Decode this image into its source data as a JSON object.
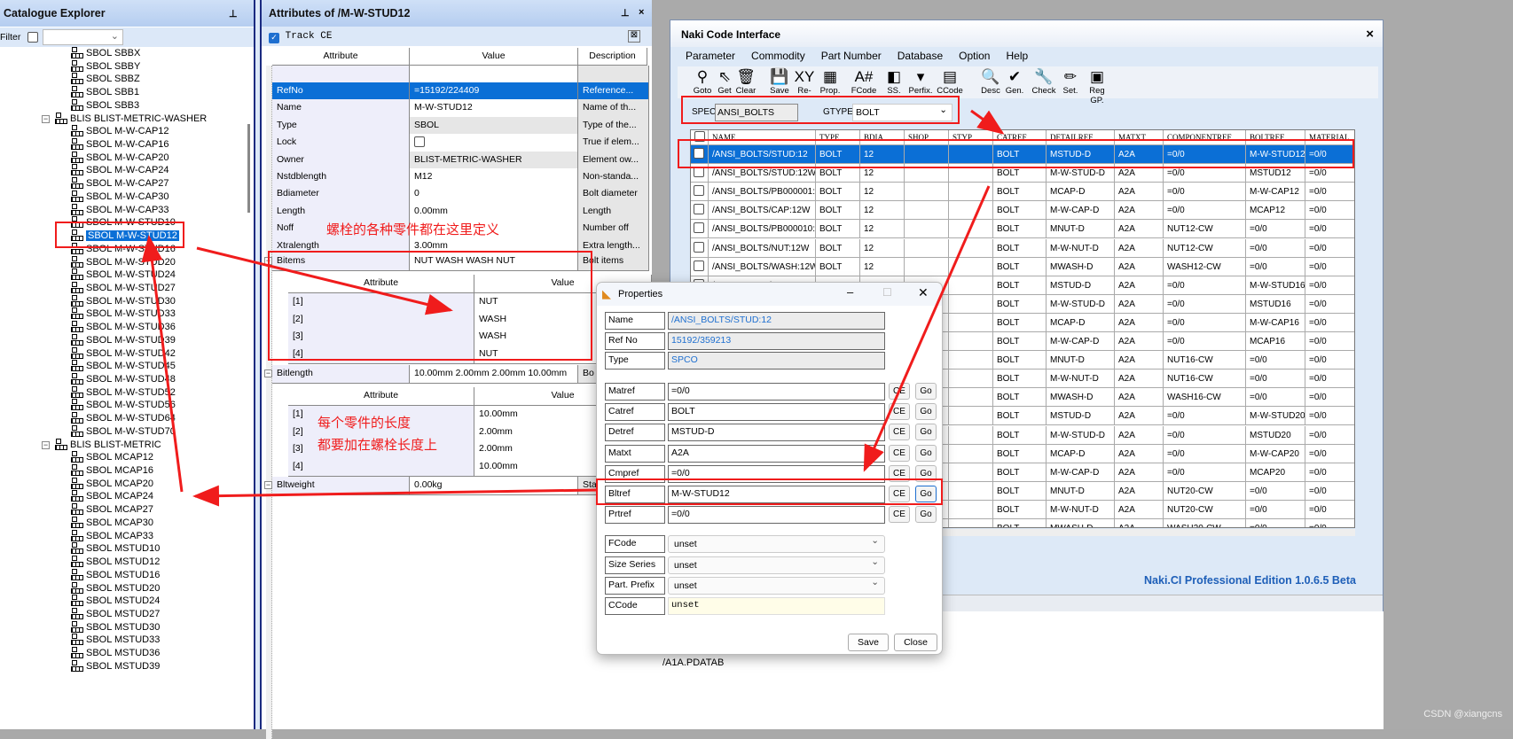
{
  "catalogue": {
    "title": "Catalogue Explorer",
    "filter_label": "Filter",
    "filter_value": "",
    "items": [
      {
        "label": "SBOL SBBX",
        "level": 1
      },
      {
        "label": "SBOL SBBY",
        "level": 1
      },
      {
        "label": "SBOL SBBZ",
        "level": 1
      },
      {
        "label": "SBOL SBB1",
        "level": 1
      },
      {
        "label": "SBOL SBB3",
        "level": 1
      },
      {
        "label": "BLIS BLIST-METRIC-WASHER",
        "level": 0
      },
      {
        "label": "SBOL M-W-CAP12",
        "level": 1
      },
      {
        "label": "SBOL M-W-CAP16",
        "level": 1
      },
      {
        "label": "SBOL M-W-CAP20",
        "level": 1
      },
      {
        "label": "SBOL M-W-CAP24",
        "level": 1
      },
      {
        "label": "SBOL M-W-CAP27",
        "level": 1
      },
      {
        "label": "SBOL M-W-CAP30",
        "level": 1
      },
      {
        "label": "SBOL M-W-CAP33",
        "level": 1
      },
      {
        "label": "SBOL M-W-STUD10",
        "level": 1
      },
      {
        "label": "SBOL M-W-STUD12",
        "level": 1,
        "selected": true
      },
      {
        "label": "SBOL M-W-STUD16",
        "level": 1
      },
      {
        "label": "SBOL M-W-STUD20",
        "level": 1
      },
      {
        "label": "SBOL M-W-STUD24",
        "level": 1
      },
      {
        "label": "SBOL M-W-STUD27",
        "level": 1
      },
      {
        "label": "SBOL M-W-STUD30",
        "level": 1
      },
      {
        "label": "SBOL M-W-STUD33",
        "level": 1
      },
      {
        "label": "SBOL M-W-STUD36",
        "level": 1
      },
      {
        "label": "SBOL M-W-STUD39",
        "level": 1
      },
      {
        "label": "SBOL M-W-STUD42",
        "level": 1
      },
      {
        "label": "SBOL M-W-STUD45",
        "level": 1
      },
      {
        "label": "SBOL M-W-STUD48",
        "level": 1
      },
      {
        "label": "SBOL M-W-STUD52",
        "level": 1
      },
      {
        "label": "SBOL M-W-STUD56",
        "level": 1
      },
      {
        "label": "SBOL M-W-STUD64",
        "level": 1
      },
      {
        "label": "SBOL M-W-STUD70",
        "level": 1
      },
      {
        "label": "BLIS BLIST-METRIC",
        "level": 0
      },
      {
        "label": "SBOL MCAP12",
        "level": 1
      },
      {
        "label": "SBOL MCAP16",
        "level": 1
      },
      {
        "label": "SBOL MCAP20",
        "level": 1
      },
      {
        "label": "SBOL MCAP24",
        "level": 1
      },
      {
        "label": "SBOL MCAP27",
        "level": 1
      },
      {
        "label": "SBOL MCAP30",
        "level": 1
      },
      {
        "label": "SBOL MCAP33",
        "level": 1
      },
      {
        "label": "SBOL MSTUD10",
        "level": 1
      },
      {
        "label": "SBOL MSTUD12",
        "level": 1
      },
      {
        "label": "SBOL MSTUD16",
        "level": 1
      },
      {
        "label": "SBOL MSTUD20",
        "level": 1
      },
      {
        "label": "SBOL MSTUD24",
        "level": 1
      },
      {
        "label": "SBOL MSTUD27",
        "level": 1
      },
      {
        "label": "SBOL MSTUD30",
        "level": 1
      },
      {
        "label": "SBOL MSTUD33",
        "level": 1
      },
      {
        "label": "SBOL MSTUD36",
        "level": 1
      },
      {
        "label": "SBOL MSTUD39",
        "level": 1
      }
    ]
  },
  "attributes": {
    "title": "Attributes of /M-W-STUD12",
    "track_ce": "Track CE",
    "headers": [
      "Attribute",
      "Value",
      "Description"
    ],
    "rows": [
      {
        "name": "RefNo",
        "value": "=15192/224409",
        "desc": "Reference...",
        "selected": true
      },
      {
        "name": "Name",
        "value": "M-W-STUD12",
        "desc": "Name of th..."
      },
      {
        "name": "Type",
        "value": "SBOL",
        "desc": "Type of the...",
        "readonly": true
      },
      {
        "name": "Lock",
        "value": "",
        "desc": "True if elem...",
        "checkbox": true
      },
      {
        "name": "Owner",
        "value": "BLIST-METRIC-WASHER",
        "desc": "Element ow...",
        "readonly": true
      },
      {
        "name": "Nstdblength",
        "value": "M12",
        "desc": "Non-standa..."
      },
      {
        "name": "Bdiameter",
        "value": "0",
        "desc": "Bolt diameter"
      },
      {
        "name": "Length",
        "value": "0.00mm",
        "desc": "Length"
      },
      {
        "name": "Noff",
        "value": "",
        "desc": "Number off"
      },
      {
        "name": "Xtralength",
        "value": "3.00mm",
        "desc": "Extra length..."
      }
    ],
    "bitems": {
      "name": "Bitems",
      "value": "NUT WASH WASH NUT",
      "desc": "Bolt items",
      "sub_headers": [
        "Attribute",
        "Value"
      ],
      "items": [
        {
          "idx": "[1]",
          "value": "NUT"
        },
        {
          "idx": "[2]",
          "value": "WASH"
        },
        {
          "idx": "[3]",
          "value": "WASH"
        },
        {
          "idx": "[4]",
          "value": "NUT"
        }
      ]
    },
    "bitlength": {
      "name": "Bitlength",
      "value": "10.00mm 2.00mm 2.00mm 10.00mm",
      "desc": "Bo",
      "sub_headers": [
        "Attribute",
        "Value"
      ],
      "items": [
        {
          "idx": "[1]",
          "value": "10.00mm"
        },
        {
          "idx": "[2]",
          "value": "2.00mm"
        },
        {
          "idx": "[3]",
          "value": "2.00mm"
        },
        {
          "idx": "[4]",
          "value": "10.00mm"
        }
      ]
    },
    "bltweight": {
      "name": "Bltweight",
      "value": "0.00kg",
      "desc": "Sta"
    }
  },
  "naki": {
    "title": "Naki Code Interface",
    "close": "×",
    "menu": [
      "Parameter",
      "Commodity",
      "Part Number",
      "Database",
      "Option",
      "Help"
    ],
    "toolbar": [
      {
        "label": "Goto",
        "icon": "goto-icon",
        "glyph": "⚲"
      },
      {
        "label": "Get",
        "icon": "cursor-icon",
        "glyph": "⇖"
      },
      {
        "label": "Clear",
        "icon": "trash-icon",
        "glyph": "🗑"
      },
      {
        "label": "Save",
        "icon": "floppy-icon",
        "glyph": "💾"
      },
      {
        "label": "Re-",
        "icon": "xy-icon",
        "glyph": "XY"
      },
      {
        "label": "Prop.",
        "icon": "grid-icon",
        "glyph": "▦"
      },
      {
        "label": "FCode",
        "icon": "format-icon",
        "glyph": "A#"
      },
      {
        "label": "SS.",
        "icon": "squares-icon",
        "glyph": "◧"
      },
      {
        "label": "Perfix.",
        "icon": "perfix-icon",
        "glyph": "▾"
      },
      {
        "label": "CCode",
        "icon": "ccode-icon",
        "glyph": "▤"
      },
      {
        "label": "Desc",
        "icon": "search-icon",
        "glyph": "🔍"
      },
      {
        "label": "Gen.",
        "icon": "check-icon",
        "glyph": "✔"
      },
      {
        "label": "Check",
        "icon": "wrench-icon",
        "glyph": "🔧"
      },
      {
        "label": "Set.",
        "icon": "pencil-icon",
        "glyph": "✏"
      },
      {
        "label": "Reg GP.",
        "icon": "box-icon",
        "glyph": "▣"
      }
    ],
    "spec_label": "SPEC",
    "spec_value": "ANSI_BOLTS",
    "gtype_label": "GTYPE",
    "gtype_value": "BOLT",
    "columns": [
      "NAME",
      "TYPE",
      "BDIA",
      "SHOP",
      "STYP",
      "CATREF",
      "DETAILREF",
      "MATXT",
      "COMPONENTREF",
      "BOLTREF",
      "MATERIAL"
    ],
    "rows": [
      [
        "/ANSI_BOLTS/STUD:12",
        "BOLT",
        "12",
        "",
        "",
        "BOLT",
        "MSTUD-D",
        "A2A",
        "=0/0",
        "M-W-STUD12",
        "=0/0"
      ],
      [
        "/ANSI_BOLTS/STUD:12W",
        "BOLT",
        "12",
        "",
        "",
        "BOLT",
        "M-W-STUD-D",
        "A2A",
        "=0/0",
        "MSTUD12",
        "=0/0"
      ],
      [
        "/ANSI_BOLTS/PB000001:12",
        "BOLT",
        "12",
        "",
        "",
        "BOLT",
        "MCAP-D",
        "A2A",
        "=0/0",
        "M-W-CAP12",
        "=0/0"
      ],
      [
        "/ANSI_BOLTS/CAP:12W",
        "BOLT",
        "12",
        "",
        "",
        "BOLT",
        "M-W-CAP-D",
        "A2A",
        "=0/0",
        "MCAP12",
        "=0/0"
      ],
      [
        "/ANSI_BOLTS/PB000010:12",
        "BOLT",
        "12",
        "",
        "",
        "BOLT",
        "MNUT-D",
        "A2A",
        "NUT12-CW",
        "=0/0",
        "=0/0"
      ],
      [
        "/ANSI_BOLTS/NUT:12W",
        "BOLT",
        "12",
        "",
        "",
        "BOLT",
        "M-W-NUT-D",
        "A2A",
        "NUT12-CW",
        "=0/0",
        "=0/0"
      ],
      [
        "/ANSI_BOLTS/WASH:12W",
        "BOLT",
        "12",
        "",
        "",
        "BOLT",
        "MWASH-D",
        "A2A",
        "WASH12-CW",
        "=0/0",
        "=0/0"
      ],
      [
        "/ANSI_BOLTS/STUD:16",
        "BOLT",
        "16",
        "",
        "",
        "BOLT",
        "MSTUD-D",
        "A2A",
        "=0/0",
        "M-W-STUD16",
        "=0/0"
      ],
      [
        "",
        "",
        "",
        "",
        "",
        "BOLT",
        "M-W-STUD-D",
        "A2A",
        "=0/0",
        "MSTUD16",
        "=0/0"
      ],
      [
        "",
        "",
        "",
        "",
        "",
        "BOLT",
        "MCAP-D",
        "A2A",
        "=0/0",
        "M-W-CAP16",
        "=0/0"
      ],
      [
        "",
        "",
        "",
        "",
        "",
        "BOLT",
        "M-W-CAP-D",
        "A2A",
        "=0/0",
        "MCAP16",
        "=0/0"
      ],
      [
        "",
        "",
        "",
        "",
        "",
        "BOLT",
        "MNUT-D",
        "A2A",
        "NUT16-CW",
        "=0/0",
        "=0/0"
      ],
      [
        "",
        "",
        "",
        "",
        "",
        "BOLT",
        "M-W-NUT-D",
        "A2A",
        "NUT16-CW",
        "=0/0",
        "=0/0"
      ],
      [
        "",
        "",
        "",
        "",
        "",
        "BOLT",
        "MWASH-D",
        "A2A",
        "WASH16-CW",
        "=0/0",
        "=0/0"
      ],
      [
        "",
        "",
        "",
        "",
        "",
        "BOLT",
        "MSTUD-D",
        "A2A",
        "=0/0",
        "M-W-STUD20",
        "=0/0"
      ],
      [
        "",
        "",
        "",
        "",
        "",
        "BOLT",
        "M-W-STUD-D",
        "A2A",
        "=0/0",
        "MSTUD20",
        "=0/0"
      ],
      [
        "",
        "",
        "",
        "",
        "",
        "BOLT",
        "MCAP-D",
        "A2A",
        "=0/0",
        "M-W-CAP20",
        "=0/0"
      ],
      [
        "",
        "",
        "",
        "",
        "",
        "BOLT",
        "M-W-CAP-D",
        "A2A",
        "=0/0",
        "MCAP20",
        "=0/0"
      ],
      [
        "",
        "",
        "",
        "",
        "",
        "BOLT",
        "MNUT-D",
        "A2A",
        "NUT20-CW",
        "=0/0",
        "=0/0"
      ],
      [
        "",
        "",
        "",
        "",
        "",
        "BOLT",
        "M-W-NUT-D",
        "A2A",
        "NUT20-CW",
        "=0/0",
        "=0/0"
      ],
      [
        "",
        "",
        "",
        "",
        "",
        "BOLT",
        "MWASH-D",
        "A2A",
        "WASH20-CW",
        "=0/0",
        "=0/0"
      ]
    ],
    "footer": "Naki.CI Professional Edition 1.0.6.5 Beta"
  },
  "properties": {
    "title": "Properties",
    "readonly": [
      {
        "label": "Name",
        "value": "/ANSI_BOLTS/STUD:12"
      },
      {
        "label": "Ref No",
        "value": "15192/359213"
      },
      {
        "label": "Type",
        "value": "SPCO"
      }
    ],
    "refs": [
      {
        "label": "Matref",
        "value": "=0/0"
      },
      {
        "label": "Catref",
        "value": "BOLT"
      },
      {
        "label": "Detref",
        "value": "MSTUD-D"
      },
      {
        "label": "Matxt",
        "value": "A2A"
      },
      {
        "label": "Cmpref",
        "value": "=0/0"
      },
      {
        "label": "Bltref",
        "value": "M-W-STUD12"
      },
      {
        "label": "Prtref",
        "value": "=0/0"
      }
    ],
    "ce_label": "CE",
    "go_label": "Go",
    "selects": [
      {
        "label": "FCode",
        "value": "unset"
      },
      {
        "label": "Size Series",
        "value": "unset"
      },
      {
        "label": "Part. Prefix",
        "value": "unset"
      }
    ],
    "ccode": {
      "label": "CCode",
      "value": "unset"
    },
    "save": "Save",
    "close": "Close"
  },
  "background": {
    "path_text": "/A1A.PDATAB",
    "watermark": "CSDN @xiangcns"
  },
  "annotations": {
    "note1": "螺栓的各种零件都在这里定义",
    "note2_line1": "每个零件的长度",
    "note2_line2": "都要加在螺栓长度上"
  },
  "colors": {
    "selection": "#0b6fd6",
    "annotation": "#f01c1c",
    "footer": "#1e5fb8"
  }
}
